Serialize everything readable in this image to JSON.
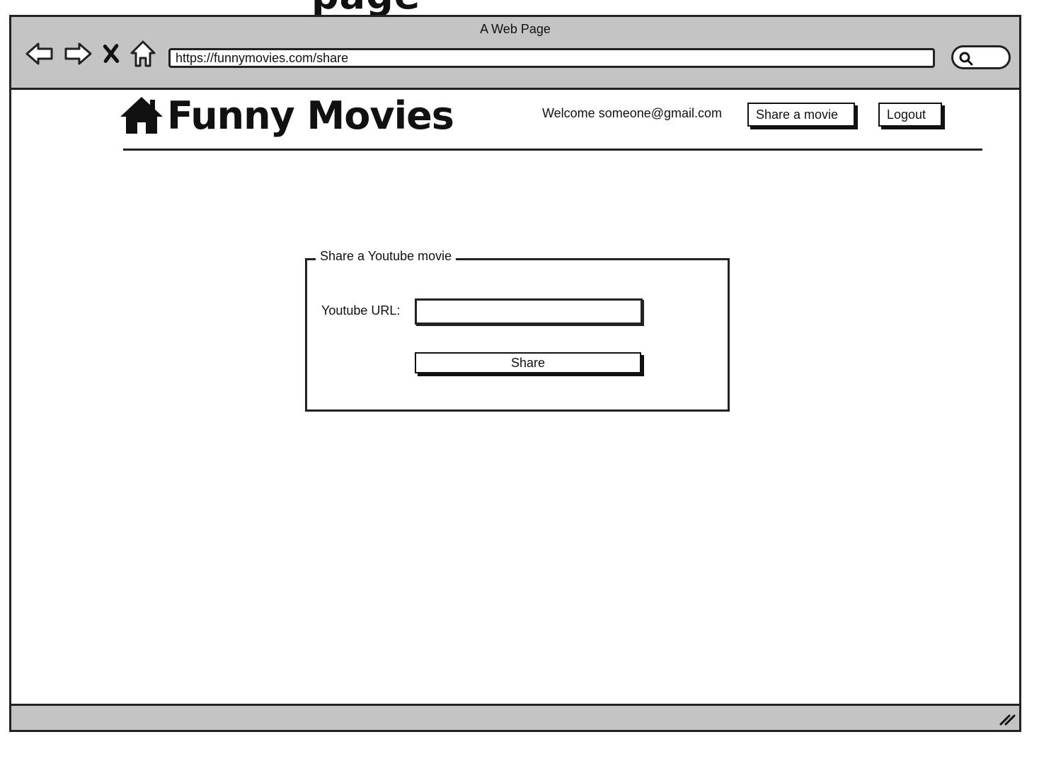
{
  "page_heading": "page",
  "browser": {
    "window_title": "A Web Page",
    "url": "https://funnymovies.com/share"
  },
  "icons": {
    "back": "arrow-left-icon",
    "forward": "arrow-right-icon",
    "stop": "close-icon",
    "home": "home-icon",
    "search": "search-icon",
    "logo": "house-icon",
    "resize": "resize-grip-icon"
  },
  "header": {
    "logo_text": "Funny Movies",
    "welcome_text": "Welcome someone@gmail.com",
    "share_button": "Share a movie",
    "logout_button": "Logout"
  },
  "share_form": {
    "legend": "Share a Youtube movie",
    "url_label": "Youtube URL:",
    "url_value": "",
    "submit_label": "Share"
  },
  "colors": {
    "chrome": "#c4c4c4",
    "ink": "#222222",
    "background": "#ffffff"
  }
}
